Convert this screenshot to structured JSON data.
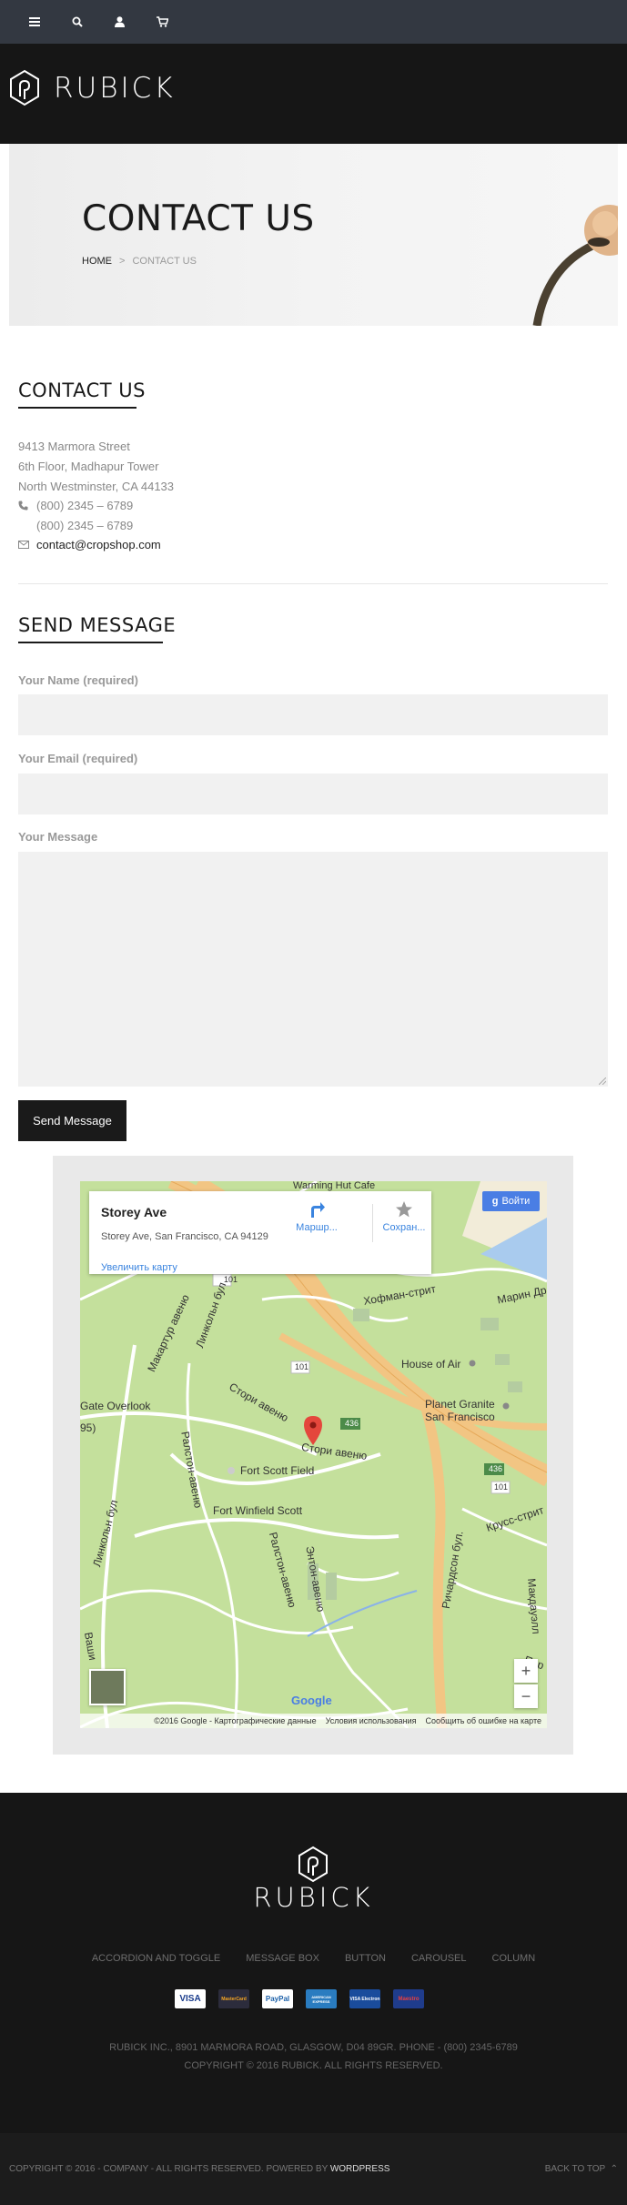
{
  "brand": {
    "name": "RUBICK"
  },
  "hero": {
    "title": "CONTACT US",
    "breadcrumb": {
      "home": "HOME",
      "sep": ">",
      "current": "CONTACT US"
    }
  },
  "contact": {
    "title": "CONTACT US",
    "address": [
      "9413 Marmora Street",
      "6th Floor, Madhapur Tower",
      "North Westminster, CA 44133"
    ],
    "phones": [
      "(800) 2345 – 6789",
      "(800) 2345 – 6789"
    ],
    "email": "contact@cropshop.com"
  },
  "form": {
    "title": "SEND MESSAGE",
    "name_label": "Your Name (required)",
    "email_label": "Your Email (required)",
    "message_label": "Your Message",
    "submit": "Send Message"
  },
  "map": {
    "place_title": "Storey Ave",
    "place_address": "Storey Ave, San Francisco, CA 94129",
    "enlarge": "Увеличить карту",
    "directions": "Маршр...",
    "save": "Сохран...",
    "signin": "Войти",
    "labels": {
      "warming": "Warming Hut Cafe",
      "house_of_air": "House of Air",
      "planet_granite": "Planet Granite",
      "planet_granite_city": "San Francisco",
      "gate_overlook": "Gate Overlook",
      "fort_scott_field": "Fort Scott Field",
      "fort_winfield": "Fort Winfield Scott",
      "storey_avenue": "Стори авеню",
      "storey_avenue2": "Стори авеню",
      "hoffman": "Хофман-стрит",
      "marina": "Марин Др",
      "lincoln1": "Линкольн бул",
      "lincoln2": "Линкольн бул",
      "ralston": "Ралстон-авеню",
      "ralston2": "Ралстон-авеню",
      "anton": "Энтон-авеню",
      "richardson": "Ричардсон бул.",
      "mcarthur": "Макартур авеню",
      "mcdowell": "Макдауэлл",
      "crissy": "Крусс-стрит",
      "washington": "Ваши",
      "par": "Пар",
      "num95": "95)",
      "r101a": "101",
      "r101b": "101",
      "r101c": "101",
      "r436": "436",
      "r436b": "436"
    },
    "footer": {
      "copyright": "©2016 Google - Картографические данные",
      "terms": "Условия использования",
      "report": "Сообщить об ошибке на карте"
    },
    "google": "Google",
    "zoom_in": "+",
    "zoom_out": "−"
  },
  "footer": {
    "brand": "RUBICK",
    "links": [
      "ACCORDION AND TOGGLE",
      "MESSAGE BOX",
      "BUTTON",
      "CAROUSEL",
      "COLUMN"
    ],
    "payments": [
      "VISA",
      "MasterCard",
      "PayPal",
      "AMERICAN EXPRESS",
      "VISA Electron",
      "Maestro"
    ],
    "address_line": "RUBICK INC., 8901 MARMORA ROAD, GLASGOW, D04 89GR. PHONE - (800) 2345-6789",
    "copyright_line": "COPYRIGHT © 2016 RUBICK. ALL RIGHTS RESERVED.",
    "bottom_left": "COPYRIGHT © 2016 - COMPANY - ALL RIGHTS RESERVED. POWERED BY",
    "bottom_left_link": "WORDPRESS",
    "back_to_top": "BACK TO TOP"
  },
  "colors": {
    "topbar": "#333841",
    "header": "#161616",
    "accent_blue": "#3a84df",
    "map_green": "#c4e09c",
    "highway": "#f2c583"
  },
  "icons": [
    "menu-icon",
    "search-icon",
    "user-icon",
    "cart-icon",
    "phone-icon",
    "mail-icon",
    "map-pin-icon",
    "directions-icon",
    "star-icon"
  ]
}
